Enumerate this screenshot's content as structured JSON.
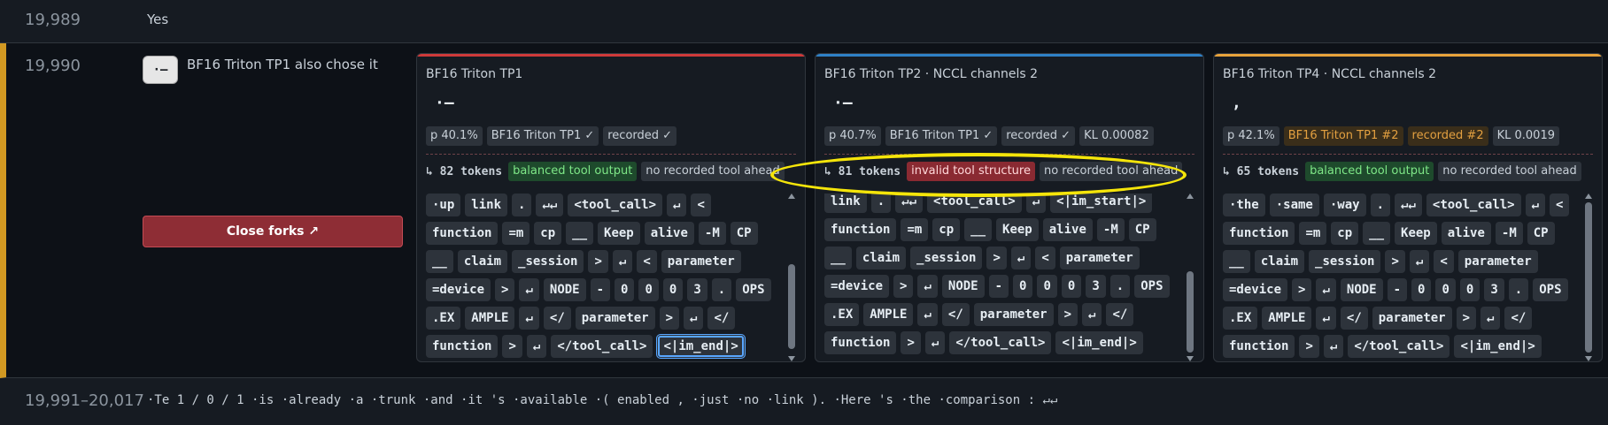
{
  "top_row": {
    "index": "19,989",
    "answer": "Yes"
  },
  "main_row": {
    "index": "19,990",
    "chosen_token": "·–",
    "chose_label": "BF16 Triton TP1 also chose it",
    "close_button": "Close forks ↗"
  },
  "panels": [
    {
      "title": "BF16 Triton TP1",
      "token": "·–",
      "badges": [
        "p 40.1%",
        "BF16 Triton TP1 ✓",
        "recorded ✓"
      ],
      "count": "↳ 82 tokens",
      "status": "balanced tool output",
      "ahead": "no recorded tool ahead",
      "rows": [
        [
          "·up",
          "link",
          ".",
          "↵↵",
          "<tool_call>",
          "↵",
          "<"
        ],
        [
          "function",
          "=m",
          "cp",
          "__",
          "Keep",
          "alive",
          "-M",
          "CP"
        ],
        [
          "__",
          "claim",
          "_session",
          ">",
          "↵",
          "<",
          "parameter"
        ],
        [
          "=device",
          ">",
          "↵",
          "NODE",
          "-",
          "0",
          "0",
          "0",
          "3",
          ".",
          "OPS"
        ],
        [
          ".EX",
          "AMPLE",
          "↵",
          "</",
          "parameter",
          ">",
          "↵",
          "</"
        ],
        [
          "function",
          ">",
          "↵",
          "</tool_call>",
          "<|im_end|>"
        ]
      ]
    },
    {
      "title": "BF16 Triton TP2 · NCCL channels 2",
      "token": "·–",
      "badges": [
        "p 40.7%",
        "BF16 Triton TP1 ✓",
        "recorded ✓",
        "KL 0.00082"
      ],
      "count": "↳ 81 tokens",
      "status": "invalid tool structure",
      "ahead": "no recorded tool ahead",
      "rows": [
        [
          "link",
          ".",
          "↵↵",
          "<tool_call>",
          "↵",
          "<|im_start|>"
        ],
        [
          "function",
          "=m",
          "cp",
          "__",
          "Keep",
          "alive",
          "-M",
          "CP"
        ],
        [
          "__",
          "claim",
          "_session",
          ">",
          "↵",
          "<",
          "parameter"
        ],
        [
          "=device",
          ">",
          "↵",
          "NODE",
          "-",
          "0",
          "0",
          "0",
          "3",
          ".",
          "OPS"
        ],
        [
          ".EX",
          "AMPLE",
          "↵",
          "</",
          "parameter",
          ">",
          "↵",
          "</"
        ],
        [
          "function",
          ">",
          "↵",
          "</tool_call>",
          "<|im_end|>"
        ]
      ]
    },
    {
      "title": "BF16 Triton TP4 · NCCL channels 2",
      "token": ",",
      "badges": [
        "p 42.1%",
        "BF16 Triton TP1 #2",
        "recorded #2",
        "KL 0.0019"
      ],
      "count": "↳ 65 tokens",
      "status": "balanced tool output",
      "ahead": "no recorded tool ahead",
      "rows": [
        [
          "·the",
          "·same",
          "·way",
          ".",
          "↵↵",
          "<tool_call>",
          "↵",
          "<"
        ],
        [
          "function",
          "=m",
          "cp",
          "__",
          "Keep",
          "alive",
          "-M",
          "CP"
        ],
        [
          "__",
          "claim",
          "_session",
          ">",
          "↵",
          "<",
          "parameter"
        ],
        [
          "=device",
          ">",
          "↵",
          "NODE",
          "-",
          "0",
          "0",
          "0",
          "3",
          ".",
          "OPS"
        ],
        [
          ".EX",
          "AMPLE",
          "↵",
          "</",
          "parameter",
          ">",
          "↵",
          "</"
        ],
        [
          "function",
          ">",
          "↵",
          "</tool_call>",
          "<|im_end|>"
        ]
      ]
    }
  ],
  "colors": {
    "panel1": "#cf3a3a",
    "panel2": "#2f81c7",
    "panel3": "#e8a33c",
    "row_accent": "#d29922",
    "highlight_ellipse": "#f5e50a"
  },
  "bottom_row": {
    "index": "19,991–20,017",
    "text": "·Te 1 / 0 / 1 ·is ·already ·a ·trunk ·and ·it 's ·available ·( enabled , ·just ·no ·link ). ·Here 's ·the ·comparison : ↵↵"
  }
}
